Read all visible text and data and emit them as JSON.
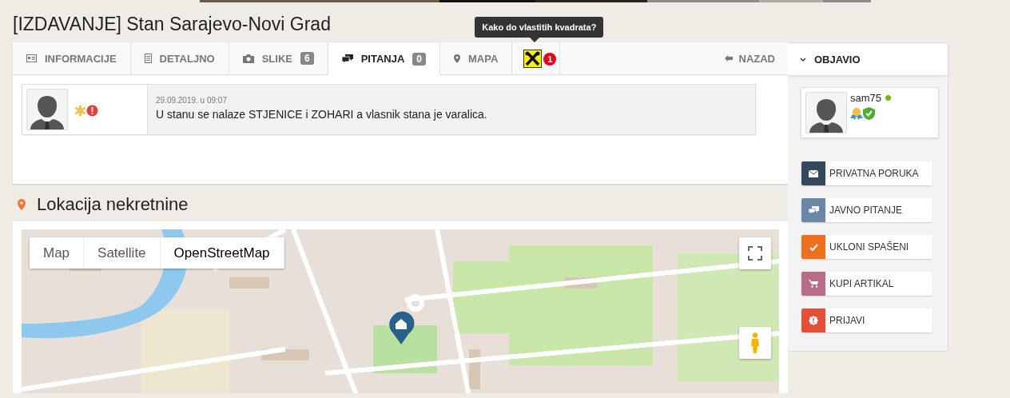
{
  "title": "[IZDAVANJE] Stan Sarajevo-Novi Grad",
  "tabs": [
    {
      "kind": "info",
      "label": "INFORMACIJE",
      "selected": false
    },
    {
      "kind": "detail",
      "label": "DETALJNO",
      "selected": false
    },
    {
      "label": "SLIKE",
      "count": "6",
      "selected": false
    },
    {
      "kind": "questions",
      "label": "PITANJA",
      "count": "0",
      "selected": true
    },
    {
      "kind": "map",
      "label": "MAPA",
      "selected": false
    },
    {
      "kind": "logo",
      "badge": "1",
      "tooltip": "Kako do vlastitih kvadrata?",
      "selected": false
    }
  ],
  "back": {
    "label": "NAZAD"
  },
  "question": {
    "date": "29.09.2019. u 09:07",
    "text": "U stanu se nalaze STJENICE i ZOHARI a vlasnik stana je varalica."
  },
  "location": {
    "heading": "Lokacija nekretnine",
    "map_types": [
      {
        "label": "Map",
        "selected": false
      },
      {
        "label": "Satellite",
        "selected": false
      },
      {
        "label": "OpenStreetMap",
        "selected": true
      }
    ]
  },
  "sidebar": {
    "heading": "OBJAVIO",
    "user": {
      "name": "sam75",
      "online": true
    },
    "actions": [
      {
        "kind": "mail",
        "label": "PRIVATNA PORUKA",
        "color": "#34495e"
      },
      {
        "kind": "chat",
        "label": "JAVNO PITANJE",
        "color": "#6a87a8"
      },
      {
        "kind": "check",
        "label": "UKLONI SPAŠENI",
        "color": "#ee6f1f"
      },
      {
        "kind": "cart",
        "label": "KUPI ARTIKAL",
        "color": "#b96b8a"
      },
      {
        "kind": "report",
        "label": "PRIJAVI",
        "color": "#e25037"
      }
    ]
  }
}
